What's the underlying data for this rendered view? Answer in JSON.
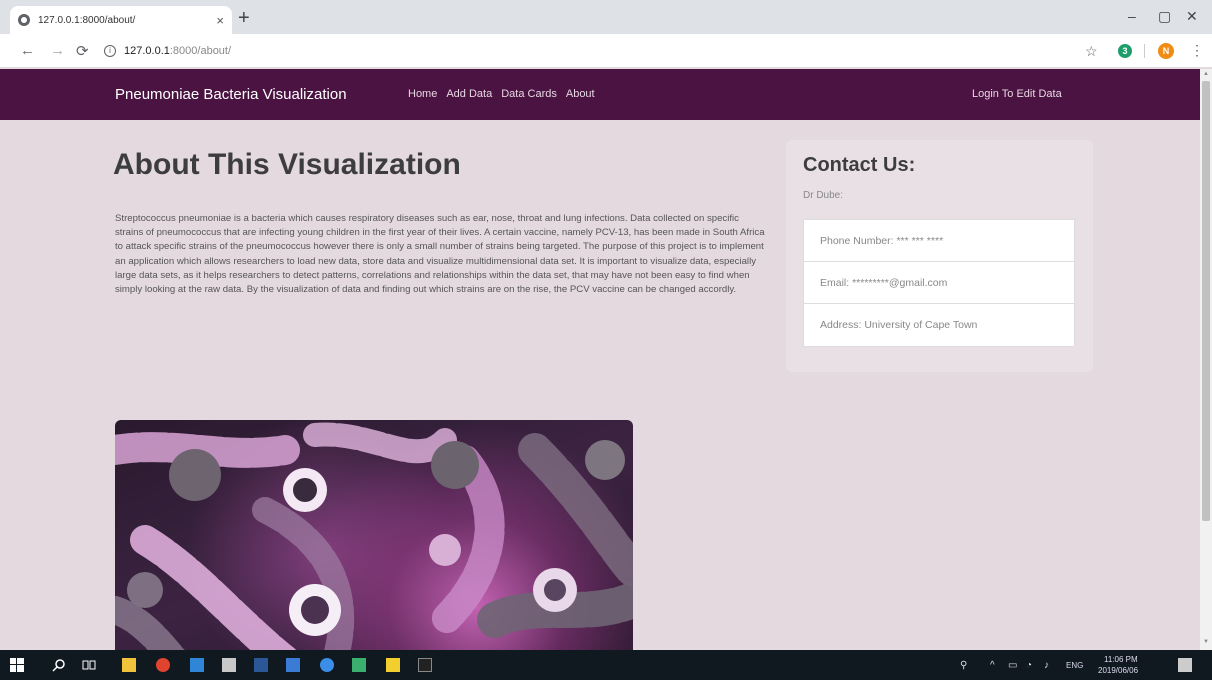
{
  "browser": {
    "tab_title": "127.0.0.1:8000/about/",
    "tab_close": "×",
    "new_tab": "+",
    "url_host": "127.0.0.1",
    "url_rest": ":8000/about/",
    "window_controls": [
      "–",
      "▢",
      "✕"
    ],
    "ext_badge": "3",
    "profile_initial": "N"
  },
  "navbar": {
    "brand": "Pneumoniae Bacteria Visualization",
    "links": [
      "Home",
      "Add Data",
      "Data Cards",
      "About"
    ],
    "login": "Login To Edit Data"
  },
  "main": {
    "title": "About This Visualization",
    "body": "Streptococcus pneumoniae is a bacteria which causes respiratory diseases such as ear, nose, throat and lung infections. Data collected on specific strains of pneumococcus that are infecting young children in the first year of their lives. A certain vaccine, namely PCV-13, has been made in South Africa to attack specific strains of the pneumococcus however there is only a small number of strains being targeted. The purpose of this project is to implement an application which allows researchers to load new data, store data and visualize multidimensional data set. It is important to visualize data, especially large data sets, as it helps researchers to detect patterns, correlations and relationships within the data set, that may have not been easy to find when simply looking at the raw data. By the visualization of data and finding out which strains are on the rise, the PCV vaccine can be changed accordly."
  },
  "contact": {
    "title": "Contact Us:",
    "name": "Dr Dube:",
    "phone": "Phone Number: *** *** ****",
    "email": "Email: *********@gmail.com",
    "address": "Address: University of Cape Town"
  },
  "taskbar": {
    "language": "ENG",
    "time": "11:06 PM",
    "date": "2019/06/06"
  },
  "colors": {
    "navbar": "#4a1342",
    "page_bg": "#e5d9e0",
    "card_bg": "#e9e0e6",
    "taskbar": "#101820"
  }
}
